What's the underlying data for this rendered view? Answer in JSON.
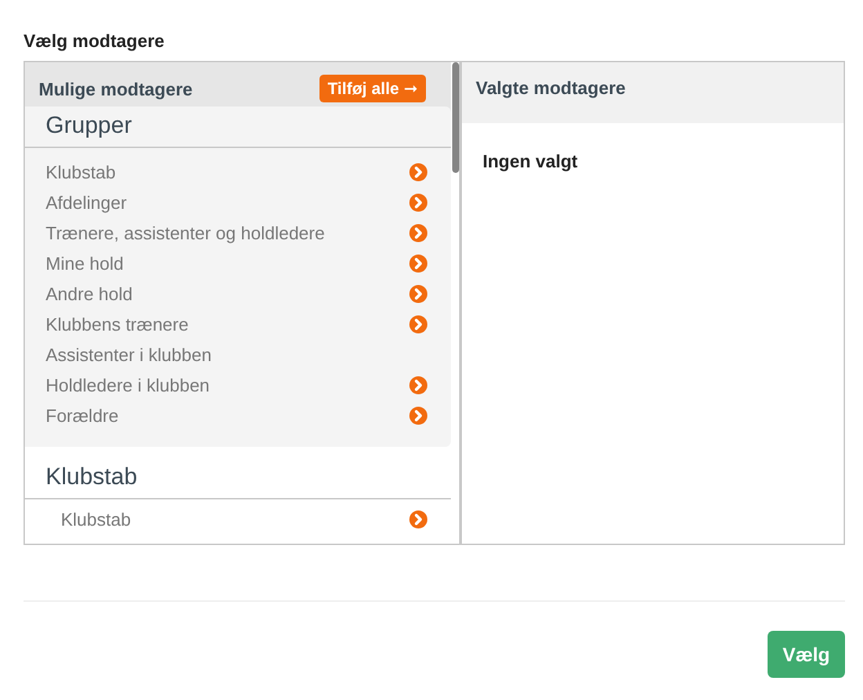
{
  "title": "Vælg modtagere",
  "available": {
    "title": "Mulige modtagere",
    "add_all_button": "Tilføj alle ➞",
    "sections": [
      {
        "title": "Grupper",
        "kind": "card",
        "items": [
          {
            "label": "Klubstab",
            "addable": true
          },
          {
            "label": "Afdelinger",
            "addable": true
          },
          {
            "label": "Trænere, assistenter og holdledere",
            "addable": true
          },
          {
            "label": "Mine hold",
            "addable": true
          },
          {
            "label": "Andre hold",
            "addable": true
          },
          {
            "label": "Klubbens trænere",
            "addable": true
          },
          {
            "label": "Assistenter i klubben",
            "addable": false
          },
          {
            "label": "Holdledere i klubben",
            "addable": true
          },
          {
            "label": "Forældre",
            "addable": true
          }
        ]
      },
      {
        "title": "Klubstab",
        "kind": "plain",
        "items": [
          {
            "label": "Klubstab",
            "addable": true
          }
        ]
      }
    ]
  },
  "selected": {
    "title": "Valgte modtagere",
    "empty_text": "Ingen valgt"
  },
  "buttons": [
    {
      "label": "Vælg"
    }
  ]
}
